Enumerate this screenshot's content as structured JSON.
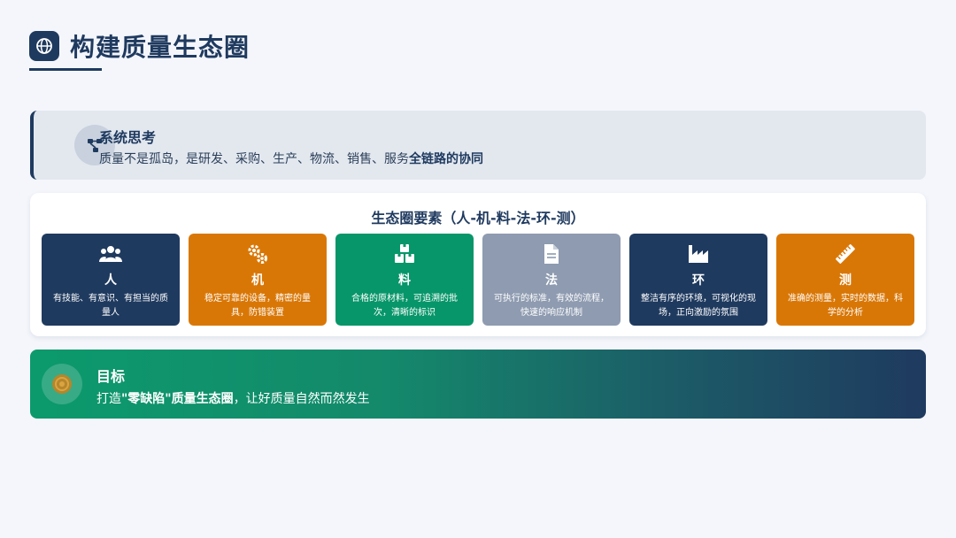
{
  "header": {
    "title": "构建质量生态圈",
    "icon": "globe-icon"
  },
  "system": {
    "icon": "network-icon",
    "title": "系统思考",
    "desc_prefix": "质量不是孤岛，是研发、采购、生产、物流、销售、服务",
    "desc_bold": "全链路的协同"
  },
  "ecosystem": {
    "title": "生态圈要素（人-机-料-法-环-测）",
    "cards": [
      {
        "icon": "users-icon",
        "title": "人",
        "desc": "有技能、有意识、有担当的质量人",
        "color": "#1f3a5f"
      },
      {
        "icon": "gears-icon",
        "title": "机",
        "desc": "稳定可靠的设备，精密的量具，防错装置",
        "color": "#d97706"
      },
      {
        "icon": "boxes-icon",
        "title": "料",
        "desc": "合格的原材料，可追溯的批次，清晰的标识",
        "color": "#079669"
      },
      {
        "icon": "document-icon",
        "title": "法",
        "desc": "可执行的标准，有效的流程，快速的响应机制",
        "color": "#8e9bb0"
      },
      {
        "icon": "factory-icon",
        "title": "环",
        "desc": "整洁有序的环境，可视化的现场，正向激励的氛围",
        "color": "#1f3a5f"
      },
      {
        "icon": "ruler-icon",
        "title": "测",
        "desc": "准确的测量，实时的数据，科学的分析",
        "color": "#d97706"
      }
    ]
  },
  "goal": {
    "icon": "target-icon",
    "title": "目标",
    "desc_prefix": "打造",
    "desc_bold": "\"零缺陷\"质量生态圈",
    "desc_suffix": "，让好质量自然而然发生"
  },
  "colors": {
    "navy": "#1f3a5f",
    "orange": "#d97706",
    "green": "#079669",
    "gray": "#8e9bb0"
  }
}
